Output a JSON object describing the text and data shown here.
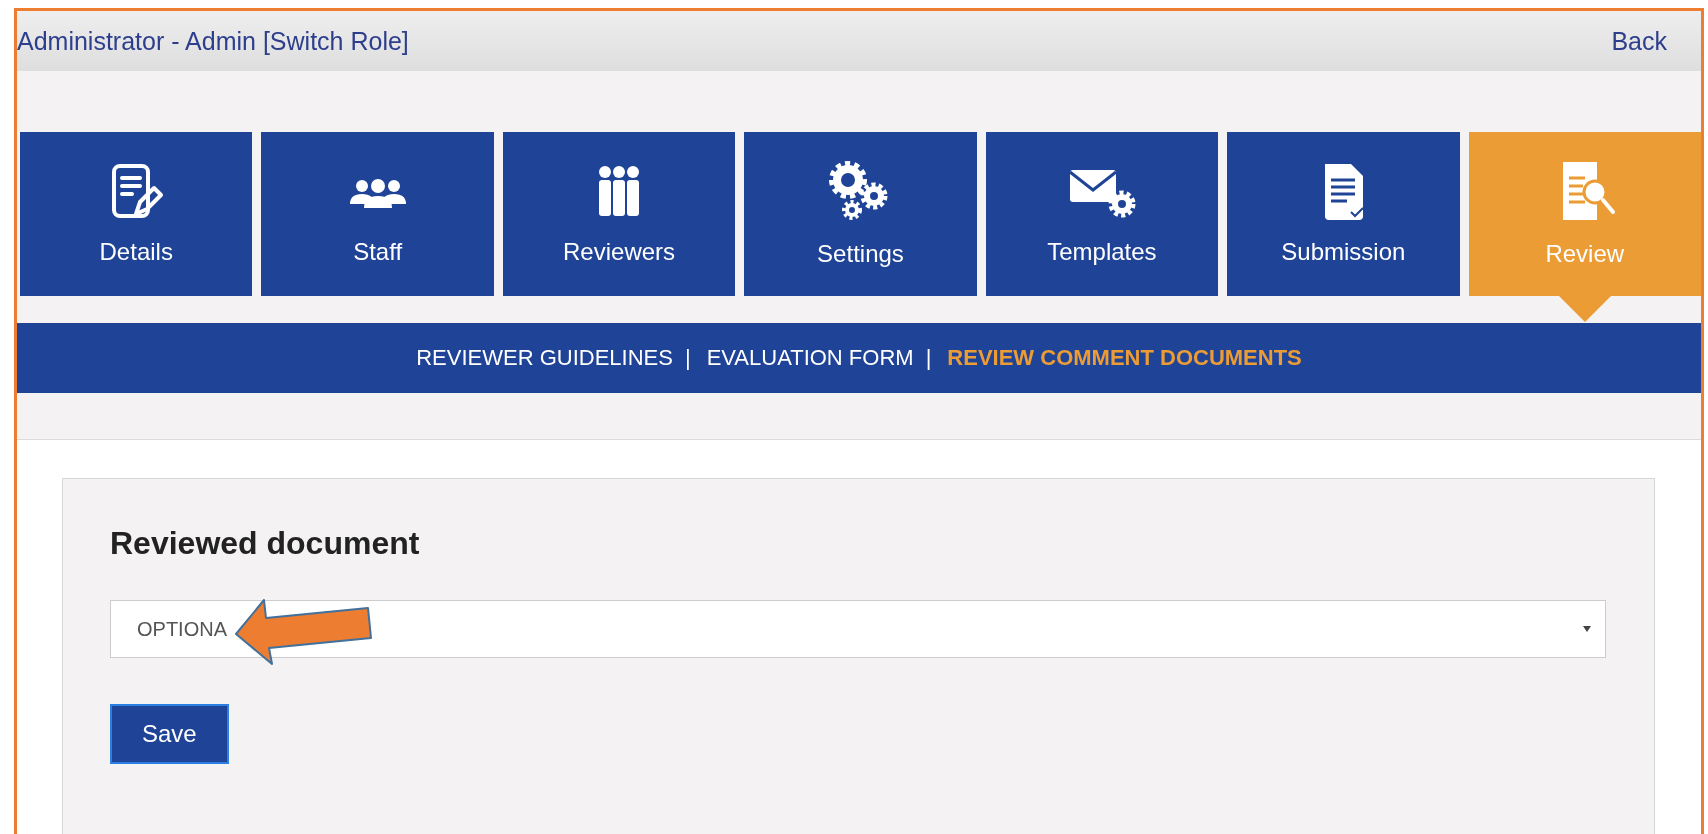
{
  "header": {
    "user": "Administrator - Admin [Switch Role]",
    "back": "Back"
  },
  "tabs": [
    {
      "label": "Details",
      "selected": false
    },
    {
      "label": "Staff",
      "selected": false
    },
    {
      "label": "Reviewers",
      "selected": false
    },
    {
      "label": "Settings",
      "selected": false
    },
    {
      "label": "Templates",
      "selected": false
    },
    {
      "label": "Submission",
      "selected": false
    },
    {
      "label": "Review",
      "selected": true
    }
  ],
  "subnav": [
    {
      "kind": "link",
      "label": "REVIEWER GUIDELINES",
      "selected": false
    },
    {
      "kind": "separator",
      "label": "|"
    },
    {
      "kind": "link",
      "label": "EVALUATION FORM",
      "selected": false
    },
    {
      "kind": "separator",
      "label": "|"
    },
    {
      "kind": "link",
      "label": "REVIEW COMMENT DOCUMENTS",
      "selected": true
    }
  ],
  "form": {
    "heading": "Reviewed document",
    "select_value": "OPTIONA",
    "save": "Save"
  }
}
